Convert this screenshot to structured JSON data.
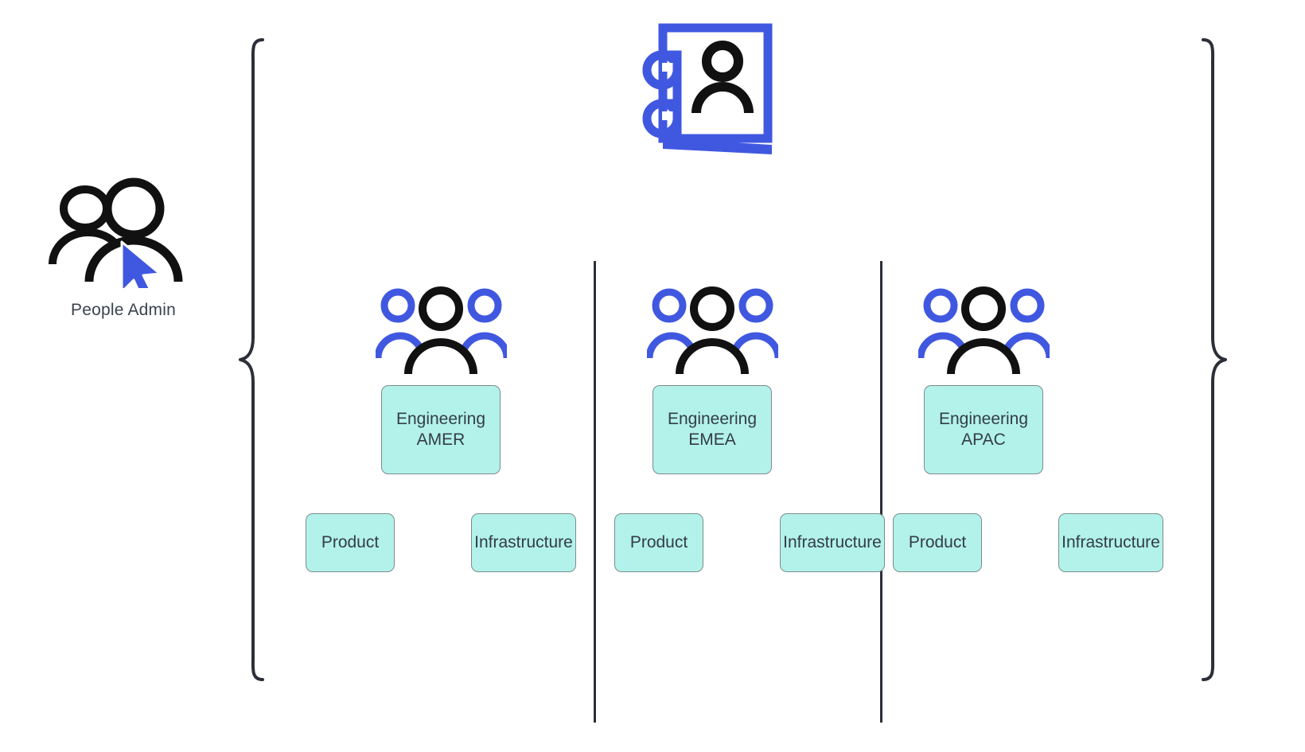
{
  "diagram": {
    "title_icon": "contact-directory-icon",
    "admin": {
      "label": "People Admin",
      "icon": "people-with-cursor-icon",
      "cursor_color": "#4058e0"
    },
    "colors": {
      "accent_blue": "#4058e0",
      "outline_black": "#111111",
      "box_fill": "#b2f2ea",
      "box_border": "#7d8c8c",
      "box_text": "#343c48",
      "divider": "#2b2f38",
      "brace": "#2b2f38"
    },
    "regions": [
      {
        "icon": "group-of-three-people-icon",
        "team_line1": "Engineering",
        "team_line2": "AMER",
        "subteams": [
          {
            "label": "Product"
          },
          {
            "label": "Infrastructure"
          }
        ]
      },
      {
        "icon": "group-of-three-people-icon",
        "team_line1": "Engineering",
        "team_line2": "EMEA",
        "subteams": [
          {
            "label": "Product"
          },
          {
            "label": "Infrastructure"
          }
        ]
      },
      {
        "icon": "group-of-three-people-icon",
        "team_line1": "Engineering",
        "team_line2": "APAC",
        "subteams": [
          {
            "label": "Product"
          },
          {
            "label": "Infrastructure"
          }
        ]
      }
    ]
  }
}
